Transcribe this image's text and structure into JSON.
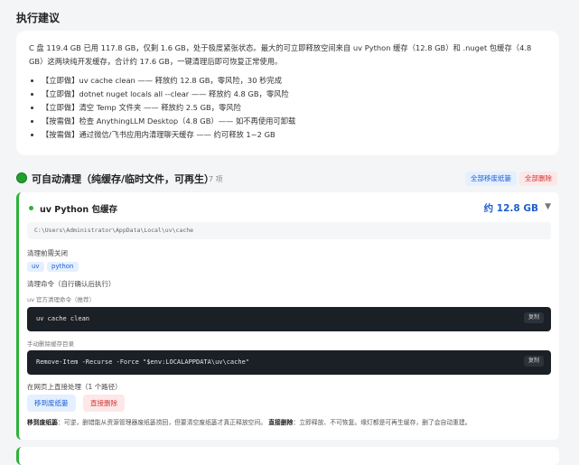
{
  "page_title": "执行建议",
  "recommendation": {
    "summary": "C 盘 119.4 GB 已用 117.8 GB，仅剩 1.6 GB，处于极度紧张状态。最大的可立即释放空间来自 uv Python 缓存（12.8 GB）和 .nuget 包缓存（4.8 GB）这两块纯开发缓存，合计约 17.6 GB，一键清理后即可恢复正常使用。",
    "items": [
      "【立即做】uv cache clean —— 释放约 12.8 GB，零风险，30 秒完成",
      "【立即做】dotnet nuget locals all --clear —— 释放约 4.8 GB，零风险",
      "【立即做】清空 Temp 文件夹 —— 释放约 2.5 GB，零风险",
      "【按需做】检查 AnythingLLM Desktop（4.8 GB）—— 如不再使用可卸载",
      "【按需做】通过微信/飞书应用内清理聊天缓存 —— 约可释放 1~2 GB"
    ]
  },
  "section": {
    "title": "可自动清理（纯缓存/临时文件，可再生）",
    "count": "7 项",
    "recycle_all_label": "全部移废纸篓",
    "delete_all_label": "全部删除",
    "accent_color": "#1fa12d"
  },
  "item": {
    "name": "uv Python 包缓存",
    "size": "约 12.8 GB",
    "toggle_icon": "▼",
    "path": "C:\\Users\\Administrator\\AppData\\Local\\uv\\cache",
    "close_label": "清理前需关闭",
    "tags": [
      "uv",
      "python"
    ],
    "commands_label": "清理命令（自行确认后执行）",
    "cmd1_caption": "uv 官方清理命令（推荐）",
    "cmd1": "uv cache clean",
    "cmd2_caption": "手动删除缓存目录",
    "cmd2": "Remove-Item -Recurse -Force \"$env:LOCALAPPDATA\\uv\\cache\"",
    "copy_label": "复制",
    "direct_label": "在网页上直接处理（1 个路径）",
    "recycle_label": "移到废纸篓",
    "delete_label": "直接删除",
    "note_recycle_title": "移到废纸篓",
    "note_recycle_text": "：可逆，删错能从资源管理器废纸篓捞回，但要清空废纸篓才真正释放空间。",
    "note_delete_title": "直接删除",
    "note_delete_text": "：立即释放、不可恢复。缘灯都是可再生缓存，删了会自动重建。"
  },
  "colors": {
    "primary_blue": "#1e5fd1",
    "danger_red": "#d13434",
    "success_green": "#2db339"
  }
}
